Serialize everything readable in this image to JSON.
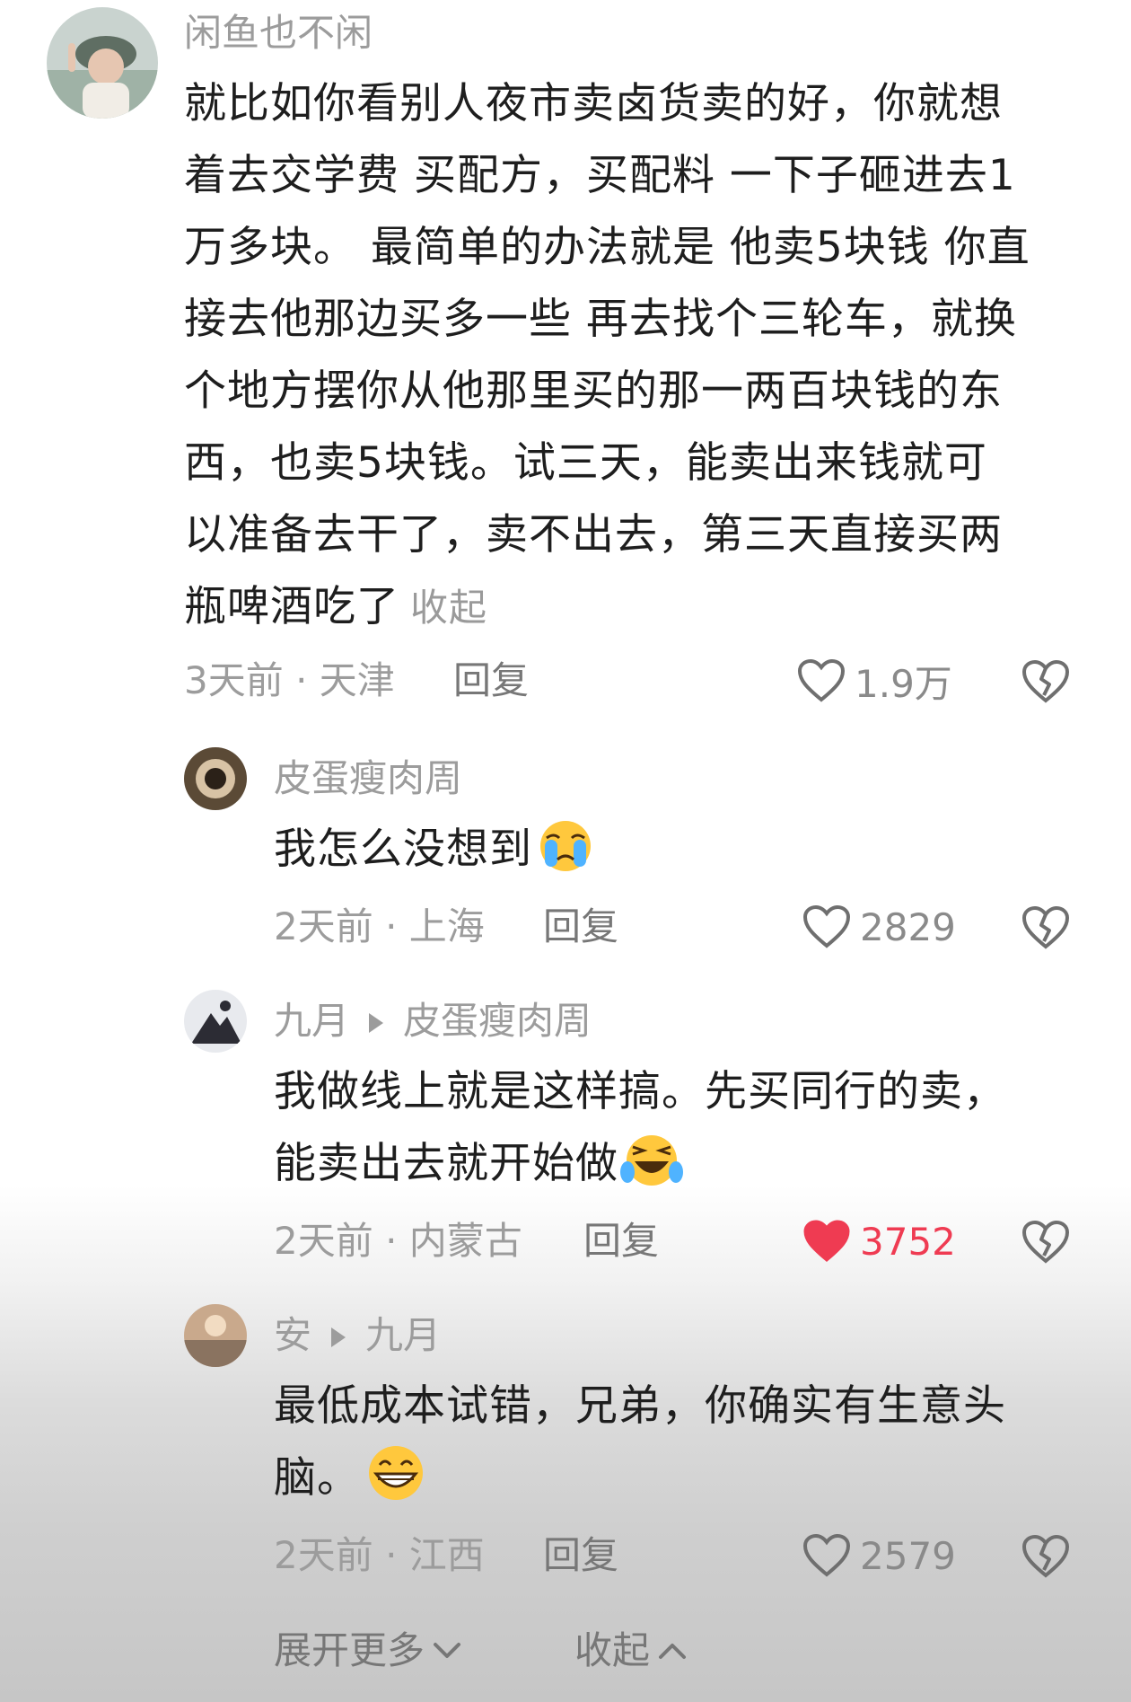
{
  "comments": [
    {
      "author": "闲鱼也不闲",
      "lines": [
        "就比如你看别人夜市卖卤货卖的好，你就想",
        "着去交学费 买配方，买配料 一下子砸进去1",
        "万多块。 最简单的办法就是 他卖5块钱 你直",
        "接去他那边买多一些 再去找个三轮车，就换",
        "个地方摆你从他那里买的那一两百块钱的东",
        "西，也卖5块钱。试三天，能卖出来钱就可",
        "以准备去干了，卖不出去，第三天直接买两",
        "瓶啤酒吃了"
      ],
      "collapse_label": "收起",
      "time_location": "3天前 · 天津",
      "reply_label": "回复",
      "likes": "1.9万"
    },
    {
      "author": "皮蛋瘦肉周",
      "lines": [
        "我怎么没想到"
      ],
      "emoji": "crying-face",
      "time_location": "2天前 · 上海",
      "reply_label": "回复",
      "likes": "2829"
    },
    {
      "author": "九月",
      "reply_to": "皮蛋瘦肉周",
      "lines": [
        "我做线上就是这样搞。先买同行的卖，",
        "能卖出去就开始做"
      ],
      "emoji": "laughing-tears-face",
      "time_location": "2天前 · 内蒙古",
      "reply_label": "回复",
      "likes": "3752",
      "liked": true
    },
    {
      "author": "安",
      "reply_to": "九月",
      "lines": [
        "最低成本试错，兄弟，你确实有生意头",
        "脑。"
      ],
      "emoji": "grinning-face",
      "time_location": "2天前 · 江西",
      "reply_label": "回复",
      "likes": "2579"
    }
  ],
  "footer": {
    "expand_more": "展开更多",
    "collapse": "收起"
  },
  "colors": {
    "like_active": "#ef3b52",
    "meta_text": "#9c9c9c",
    "body_text": "#1e1e1e"
  },
  "icons": [
    "heart-outline-icon",
    "heart-filled-icon",
    "broken-heart-icon",
    "chevron-down-icon",
    "chevron-up-icon",
    "reply-arrow-icon"
  ]
}
